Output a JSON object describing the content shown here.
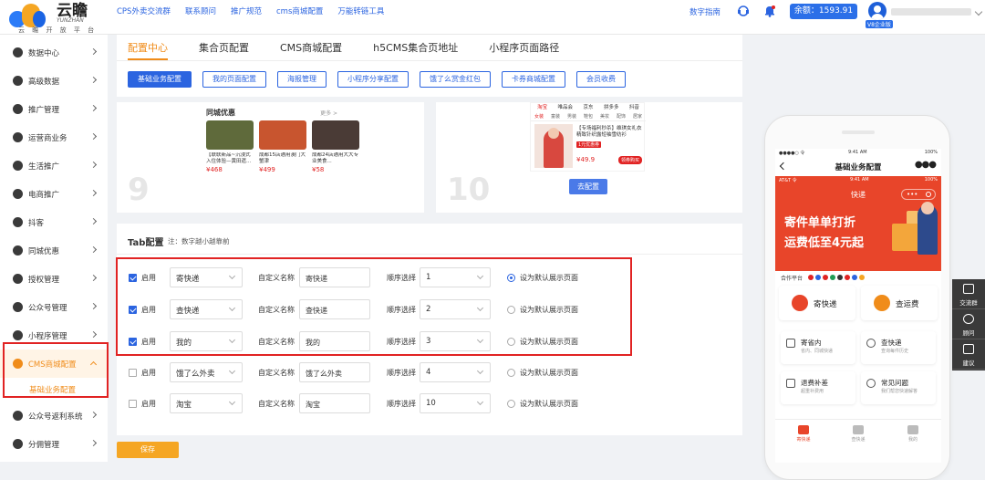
{
  "brand": {
    "name": "云瞻",
    "name_en": "YUNZHAN",
    "tagline": "云 瞻 开 放 平 台"
  },
  "topnav": [
    "CPS外卖交流群",
    "联系顾问",
    "推广规范",
    "cms商城配置",
    "万能转链工具"
  ],
  "header_right": {
    "guide": "数字指南",
    "balance": "余额：1593.91",
    "vip_badge": "V8企业版"
  },
  "sidebar": {
    "items": [
      {
        "label": "数据中心"
      },
      {
        "label": "高级数据"
      },
      {
        "label": "推广管理"
      },
      {
        "label": "运营商业务"
      },
      {
        "label": "生活推广"
      },
      {
        "label": "电商推广"
      },
      {
        "label": "抖客"
      },
      {
        "label": "同城优惠"
      },
      {
        "label": "授权管理"
      },
      {
        "label": "公众号管理"
      },
      {
        "label": "小程序管理"
      },
      {
        "label": "CMS商城配置"
      }
    ],
    "sub_item": "基础业务配置",
    "items_after": [
      {
        "label": "公众号返利系统"
      },
      {
        "label": "分佣管理"
      }
    ]
  },
  "tabs": [
    "配置中心",
    "集合页配置",
    "CMS商城配置",
    "h5CMS集合页地址",
    "小程序页面路径"
  ],
  "sub_tabs": [
    "基础业务配置",
    "我的页面配置",
    "海报管理",
    "小程序分享配置",
    "饿了么赏金红包",
    "卡券商城配置",
    "会员收费"
  ],
  "card9": {
    "number": "9",
    "preview_title": "同城优惠",
    "more": "更多 >",
    "products": [
      {
        "name": "【联联新品~沉浸式入住体验—黄田遗...",
        "price": "¥468",
        "color": "#5f6a3b"
      },
      {
        "name": "成都15店通用澳门大蟹津",
        "price": "¥499",
        "color": "#c8552f"
      },
      {
        "name": "成都24店通用大大专业美食...",
        "price": "¥58",
        "color": "#4a3b36"
      }
    ]
  },
  "card10": {
    "number": "10",
    "tabs": [
      "淘宝",
      "唯品会",
      "京东",
      "拼多多",
      "抖音"
    ],
    "subtabs": [
      "女装",
      "童装",
      "男装",
      "鞋包",
      "美妆",
      "配饰",
      "居家"
    ],
    "product_title": "【专场福利秒杀】维琪女礼衣精致针织露短袖雪纺衫",
    "tag": "1元优惠券",
    "price": "¥49.9",
    "buy": "领券购买",
    "btn": "去配置"
  },
  "tab_config": {
    "title": "Tab配置",
    "note": "注：数字越小越靠前",
    "enable_label": "启用",
    "custom_name_label": "自定义名称",
    "order_label": "顺序选择",
    "default_label": "设为默认展示页面",
    "rows": [
      {
        "service": "寄快递",
        "name": "寄快递",
        "order": "1",
        "checked": true,
        "default": true
      },
      {
        "service": "查快递",
        "name": "查快递",
        "order": "2",
        "checked": true,
        "default": false
      },
      {
        "service": "我的",
        "name": "我的",
        "order": "3",
        "checked": true,
        "default": false
      },
      {
        "service": "饿了么外卖",
        "name": "饿了么外卖",
        "order": "4",
        "checked": false,
        "default": false
      },
      {
        "service": "淘宝",
        "name": "淘宝",
        "order": "10",
        "checked": false,
        "default": false
      }
    ]
  },
  "save_label": "保存",
  "phone": {
    "status_left": "●●●●○ 令",
    "status_time": "9:41 AM",
    "status_right": "100%",
    "page_title": "基础业务配置",
    "status2_left": "AT&T 令",
    "status2_time": "9:41 AM",
    "status2_right": "100%",
    "header_title": "快递",
    "banner_line1": "寄件单单打折",
    "banner_line2": "运费低至4元起",
    "partners_label": "合作平台",
    "btn_send": "寄快递",
    "btn_fee": "查运费",
    "cards": [
      {
        "title": "寄省内",
        "sub": "省内、同城快递"
      },
      {
        "title": "查快递",
        "sub": "查询每件历史"
      },
      {
        "title": "退费补差",
        "sub": "超重补费用"
      },
      {
        "title": "常见问题",
        "sub": "我们帮您快速解答"
      }
    ],
    "tabbar": [
      "寄快递",
      "查快递",
      "我的"
    ]
  },
  "side_tools": [
    "交流群",
    "顾问",
    "建议"
  ],
  "colors": {
    "accent_orange": "#f08c1a",
    "primary_blue": "#2b64e0",
    "highlight_red": "#e12323"
  }
}
